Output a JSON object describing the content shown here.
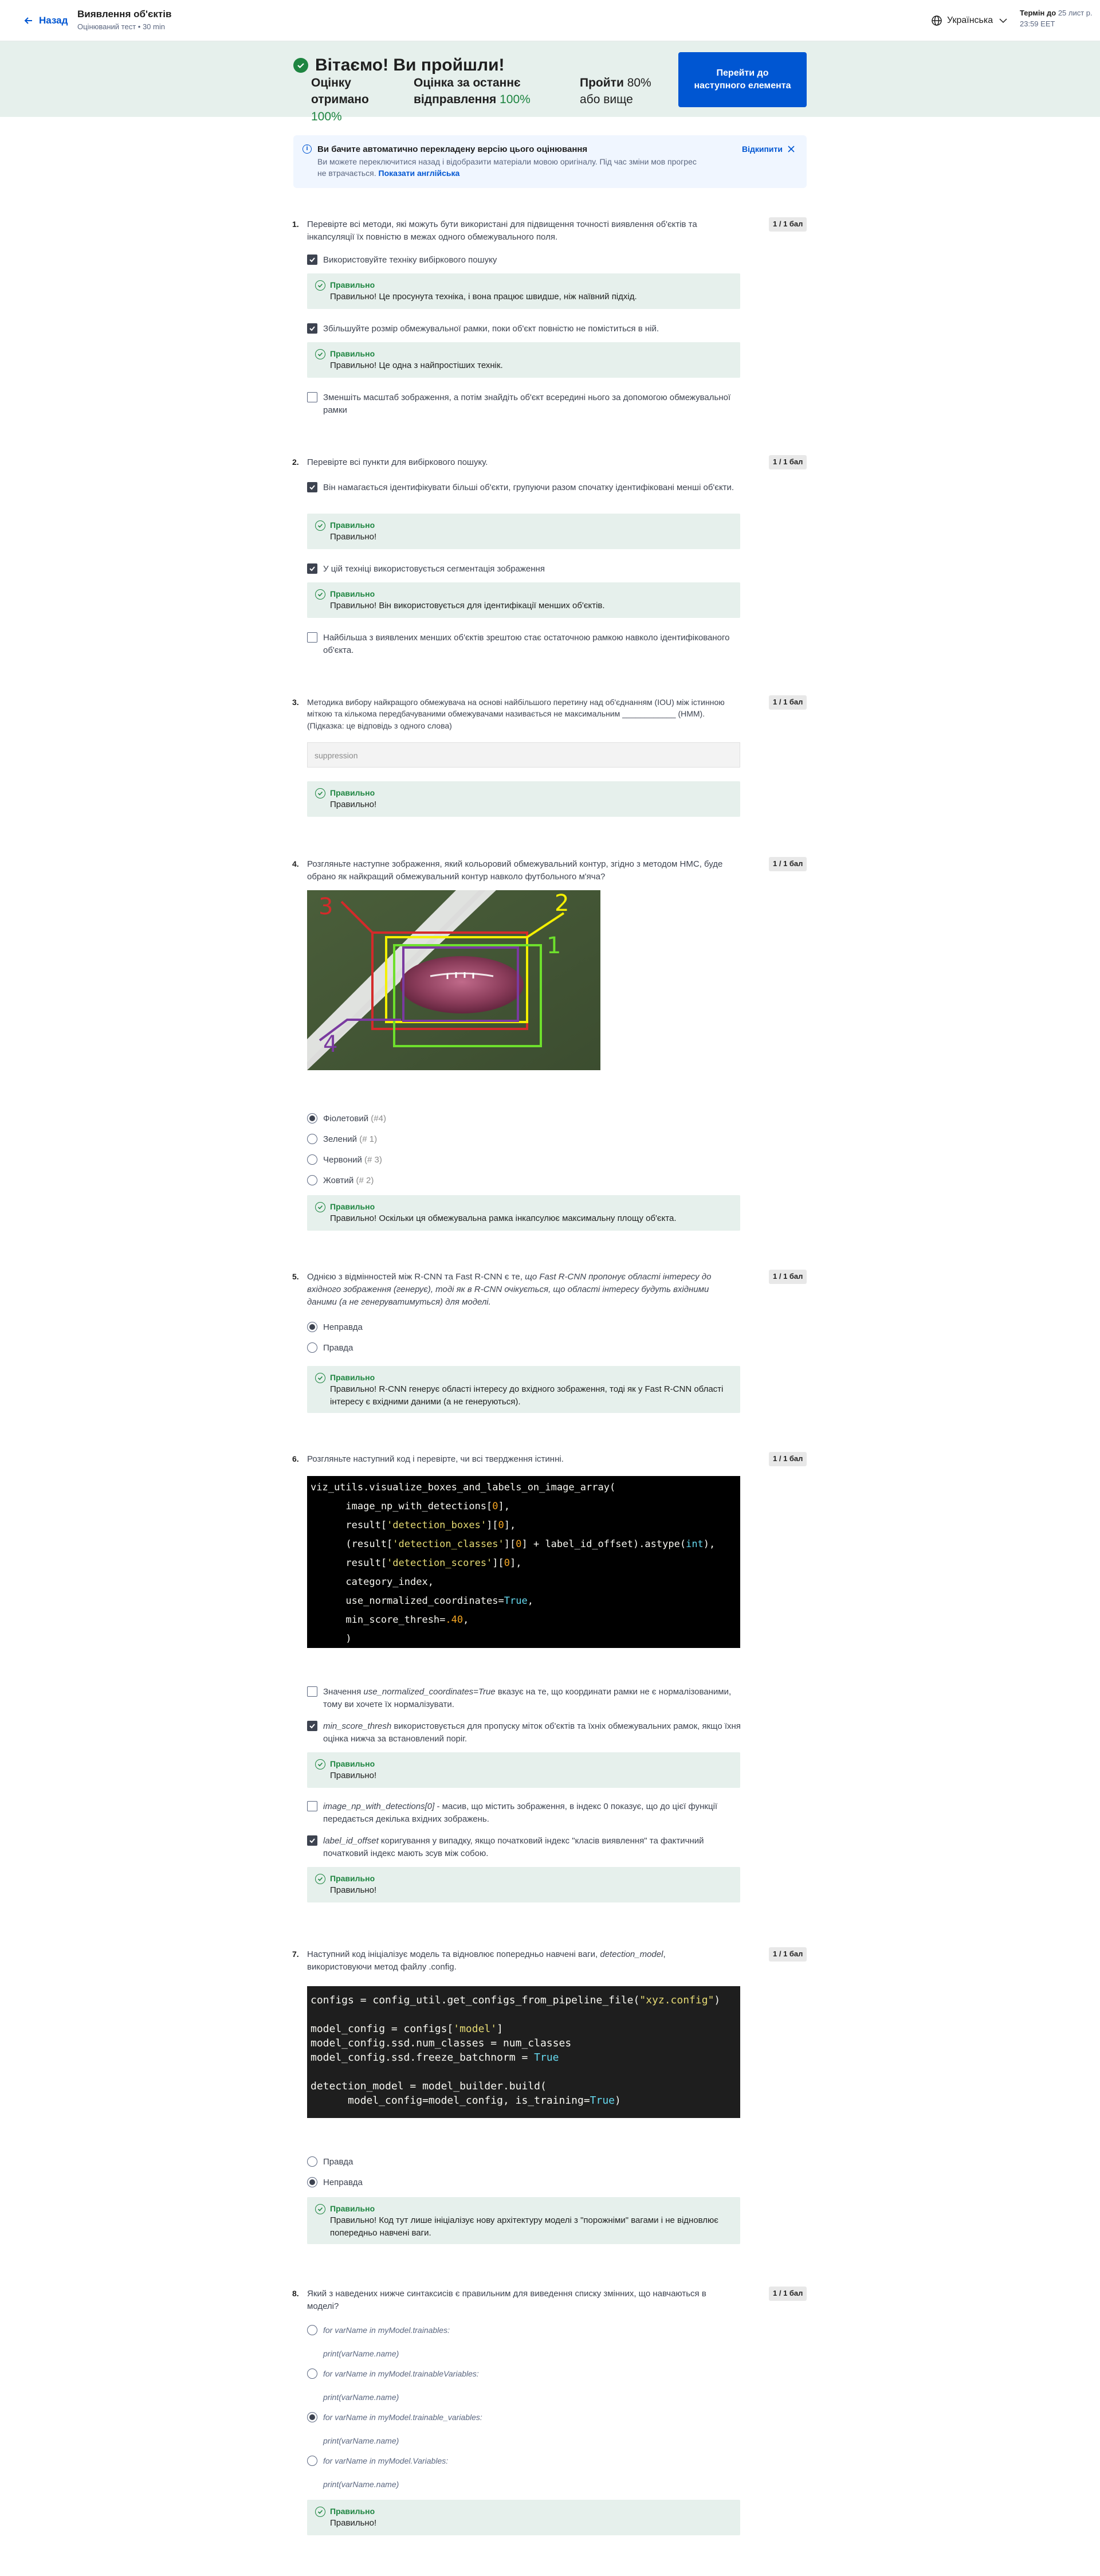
{
  "header": {
    "back_label": "Назад",
    "title": "Виявлення об'єктів",
    "subtitle": "Оцінюваний тест • 30 min",
    "language": "Українська",
    "deadline_label": "Термін до",
    "deadline_date": "25 лист р.",
    "deadline_time": "23:59 EET"
  },
  "banner": {
    "title": "Вітаємо! Ви пройшли!",
    "received_label": "Оцінку отримано",
    "received_value": "100%",
    "last_label": "Оцінка за останнє відправлення",
    "last_value": "100%",
    "pass_label": "Пройти",
    "pass_value": "80% або вище",
    "next_button": "Перейти до наступного елемента"
  },
  "notice": {
    "title": "Ви бачите автоматично перекладену версію цього оцінювання",
    "text": "Ви можете переключитися назад і відобразити матеріали мовою оригіналу. Під час зміни мов прогрес не втрачається.",
    "link": "Показати англійська",
    "hide": "Відкипити"
  },
  "questions": [
    {
      "num": "1.",
      "points": "1 / 1 бал",
      "text": "Перевірте всі методи, які можуть бути використані для підвищення точності виявлення об'єктів та інкапсуляції їх повністю в межах одного обмежувального поля.",
      "options": [
        {
          "label": "Використовуйте техніку вибіркового пошуку",
          "checked": true,
          "feedback_title": "Правильно",
          "feedback": "Правильно! Це просунута техніка, і вона працює швидше, ніж наївний підхід."
        },
        {
          "label": "Збільшуйте розмір обмежувальної рамки, поки об'єкт повністю не поміститься в ній.",
          "checked": true,
          "feedback_title": "Правильно",
          "feedback": "Правильно! Це одна з найпростіших технік."
        },
        {
          "label": "Зменшіть масштаб зображення, а потім знайдіть об'єкт всередині нього за допомогою обмежувальної рамки",
          "checked": false
        }
      ]
    },
    {
      "num": "2.",
      "points": "1 / 1 бал",
      "text": "Перевірте всі пункти для вибіркового пошуку.",
      "options": [
        {
          "label": "Він намагається ідентифікувати більші об'єкти, групуючи разом спочатку ідентифіковані менші об'єкти.",
          "checked": true,
          "feedback_title": "Правильно",
          "feedback": "Правильно!"
        },
        {
          "label": "У цій техніці використовується сегментація зображення",
          "checked": true,
          "feedback_title": "Правильно",
          "feedback": "Правильно! Він використовується для ідентифікації менших об'єктів."
        },
        {
          "label": "Найбільша з виявлених менших об'єктів зрештою стає остаточною рамкою навколо ідентифікованого об'єкта.",
          "checked": false
        }
      ]
    },
    {
      "num": "3.",
      "points": "1 / 1 бал",
      "text": "Методика вибору найкращого обмежувача на основі найбільшого перетину над об'єднанням (IOU) між істинною міткою та кількома передбачуваними обмежувачами називається не максимальним ____________ (НММ). (Підказка: це відповідь з одного слова)",
      "answer": "suppression",
      "feedback_title": "Правильно",
      "feedback": "Правильно!"
    },
    {
      "num": "4.",
      "points": "1 / 1 бал",
      "text": "Розгляньте наступне зображення, який кольоровий обмежувальний контур, згідно з методом НМС, буде обрано як найкращий обмежувальний контур навколо футбольного м'яча?",
      "image_labels": [
        "1",
        "2",
        "3",
        "4"
      ],
      "options": [
        {
          "label": "Фіолетовий",
          "hint": "(#4)",
          "selected": true
        },
        {
          "label": "Зелений",
          "hint": "(# 1)",
          "selected": false
        },
        {
          "label": "Червоний",
          "hint": "(# 3)",
          "selected": false
        },
        {
          "label": "Жовтий",
          "hint": "(# 2)",
          "selected": false
        }
      ],
      "feedback_title": "Правильно",
      "feedback": "Правильно! Оскільки ця обмежувальна рамка інкапсулює максимальну площу об'єкта."
    },
    {
      "num": "5.",
      "points": "1 / 1 бал",
      "text_a": "Однією з відмінностей між R-CNN та Fast R-CNN є те, ",
      "text_b": "що Fast R-CNN пропонує області інтересу до вхідного зображення (генерує), тоді як в R-CNN очікується, що області інтересу будуть вхідними даними (а не генеруватимуться) для моделі.",
      "options": [
        {
          "label": "Неправда",
          "selected": true
        },
        {
          "label": "Правда",
          "selected": false
        }
      ],
      "feedback_title": "Правильно",
      "feedback": "Правильно! R-CNN генерує області інтересу до вхідного зображення, тоді як у Fast R-CNN області інтересу є вхідними даними (а не генеруються)."
    },
    {
      "num": "6.",
      "points": "1 / 1 бал",
      "text": "Розгляньте наступний код і перевірте, чи всі твердження істинні.",
      "options": [
        {
          "code": "use_normalized_coordinates=True",
          "label_a": "Значення ",
          "label_b": " вказує на те, що координати рамки не є нормалізованими, тому ви хочете їх нормалізувати.",
          "checked": false
        },
        {
          "code": "min_score_thresh",
          "label_a": "",
          "label_b": " використовується для пропуску міток об'єктів та їхніх обмежувальних рамок, якщо їхня оцінка нижча за встановлений поріг.",
          "checked": true,
          "feedback_title": "Правильно",
          "feedback": "Правильно!"
        },
        {
          "code": "image_np_with_detections[0]",
          "label_a": "",
          "label_b": " - масив, що містить зображення, в індекс 0 показує, що до цієї функції передається декілька вхідних зображень.",
          "checked": false
        },
        {
          "code": "label_id_offset",
          "label_a": "",
          "label_b": " коригування у випадку, якщо початковий індекс \"класів виявлення\" та фактичний початковий індекс мають зсув між собою.",
          "checked": true,
          "feedback_title": "Правильно",
          "feedback": "Правильно!"
        }
      ]
    },
    {
      "num": "7.",
      "points": "1 / 1 бал",
      "text_a": "Наступний код ініціалізує модель та відновлює попередньо навчені ваги, ",
      "text_code": "detection_model",
      "text_b": ", використовуючи метод файлу .config.",
      "options": [
        {
          "label": "Правда",
          "selected": false
        },
        {
          "label": "Неправда",
          "selected": true
        }
      ],
      "feedback_title": "Правильно",
      "feedback": "Правильно! Код тут лише ініціалізує нову архітектуру моделі з \"порожніми\" вагами і не відновлює попередньо навчені ваги."
    },
    {
      "num": "8.",
      "points": "1 / 1 бал",
      "text": "Який з наведених нижче синтаксисів є правильним для виведення списку змінних, що навчаються в моделі?",
      "options": [
        {
          "line1": "for varName in myModel.trainables:",
          "line2": "print(varName.name)",
          "selected": false
        },
        {
          "line1": "for varName in myModel.trainableVariables:",
          "line2": "print(varName.name)",
          "selected": false
        },
        {
          "line1": "for varName in myModel.trainable_variables:",
          "line2": "print(varName.name)",
          "selected": true
        },
        {
          "line1": "for varName in myModel.Variables:",
          "line2": "print(varName.name)",
          "selected": false
        }
      ],
      "feedback_title": "Правильно",
      "feedback": "Правильно!"
    }
  ],
  "colors": {
    "accent": "#0056d2",
    "success": "#1e8541",
    "banner_bg": "#e6f0ec"
  }
}
